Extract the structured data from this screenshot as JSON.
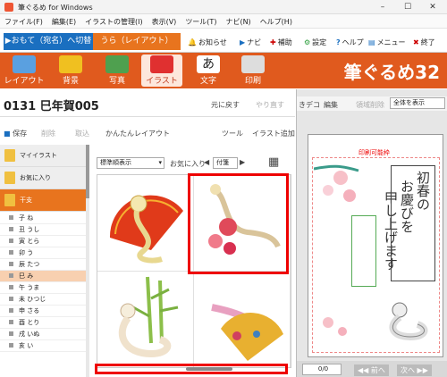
{
  "window": {
    "title": "筆ぐるめ for Windows",
    "minimize": "–",
    "maximize": "☐",
    "close": "✕"
  },
  "menu": [
    "ファイル(F)",
    "編集(E)",
    "イラストの管理(I)",
    "表示(V)",
    "ツール(T)",
    "ナビ(N)",
    "ヘルプ(H)"
  ],
  "mode": {
    "front": "▶おもて（宛名）へ切替",
    "back": "うら（レイアウト）"
  },
  "toolbar": {
    "news": "お知らせ",
    "navi": "ナビ",
    "assist": "補助",
    "settings": "設定",
    "help": "ヘルプ",
    "menu": "メニュー",
    "exit": "終了"
  },
  "ribbon": {
    "items": [
      "レイアウト",
      "背景",
      "写真",
      "イラスト",
      "文字",
      "印刷"
    ],
    "logo": "筆ぐるめ32"
  },
  "project": {
    "title": "0131  巳年賀005",
    "undo": "元に戻す",
    "redo": "やり直す"
  },
  "actions": {
    "save": "保存",
    "delete": "削除",
    "import": "取込",
    "easy_layout": "かんたんレイアウト",
    "tools": "ツール",
    "add_illust": "イラスト追加"
  },
  "categories": {
    "top": [
      "マイイラスト",
      "お気に入り",
      "干支"
    ],
    "sub": [
      "子 ね",
      "丑 うし",
      "寅 とら",
      "卯 う",
      "辰 たつ",
      "巳 み",
      "午 うま",
      "未 ひつじ",
      "申 さる",
      "酉 とり",
      "戌 いぬ",
      "亥 い"
    ],
    "selected_sub": "巳 み"
  },
  "view": {
    "sort": "標準順表示",
    "favorite_label": "お気に入り",
    "favorite_value": "付箋"
  },
  "preview": {
    "toolbar_left": "きデコ",
    "toolbar_edit": "編集",
    "toolbar_area": "領域削除",
    "zoom": "全体を表示",
    "print_area": "印刷可能枠",
    "greeting_main": "初春の",
    "greeting_2": "お慶びを",
    "greeting_3": "申し上げます",
    "page": "0/0",
    "prev": "◀◀ 前へ",
    "next": "次へ ▶▶"
  }
}
